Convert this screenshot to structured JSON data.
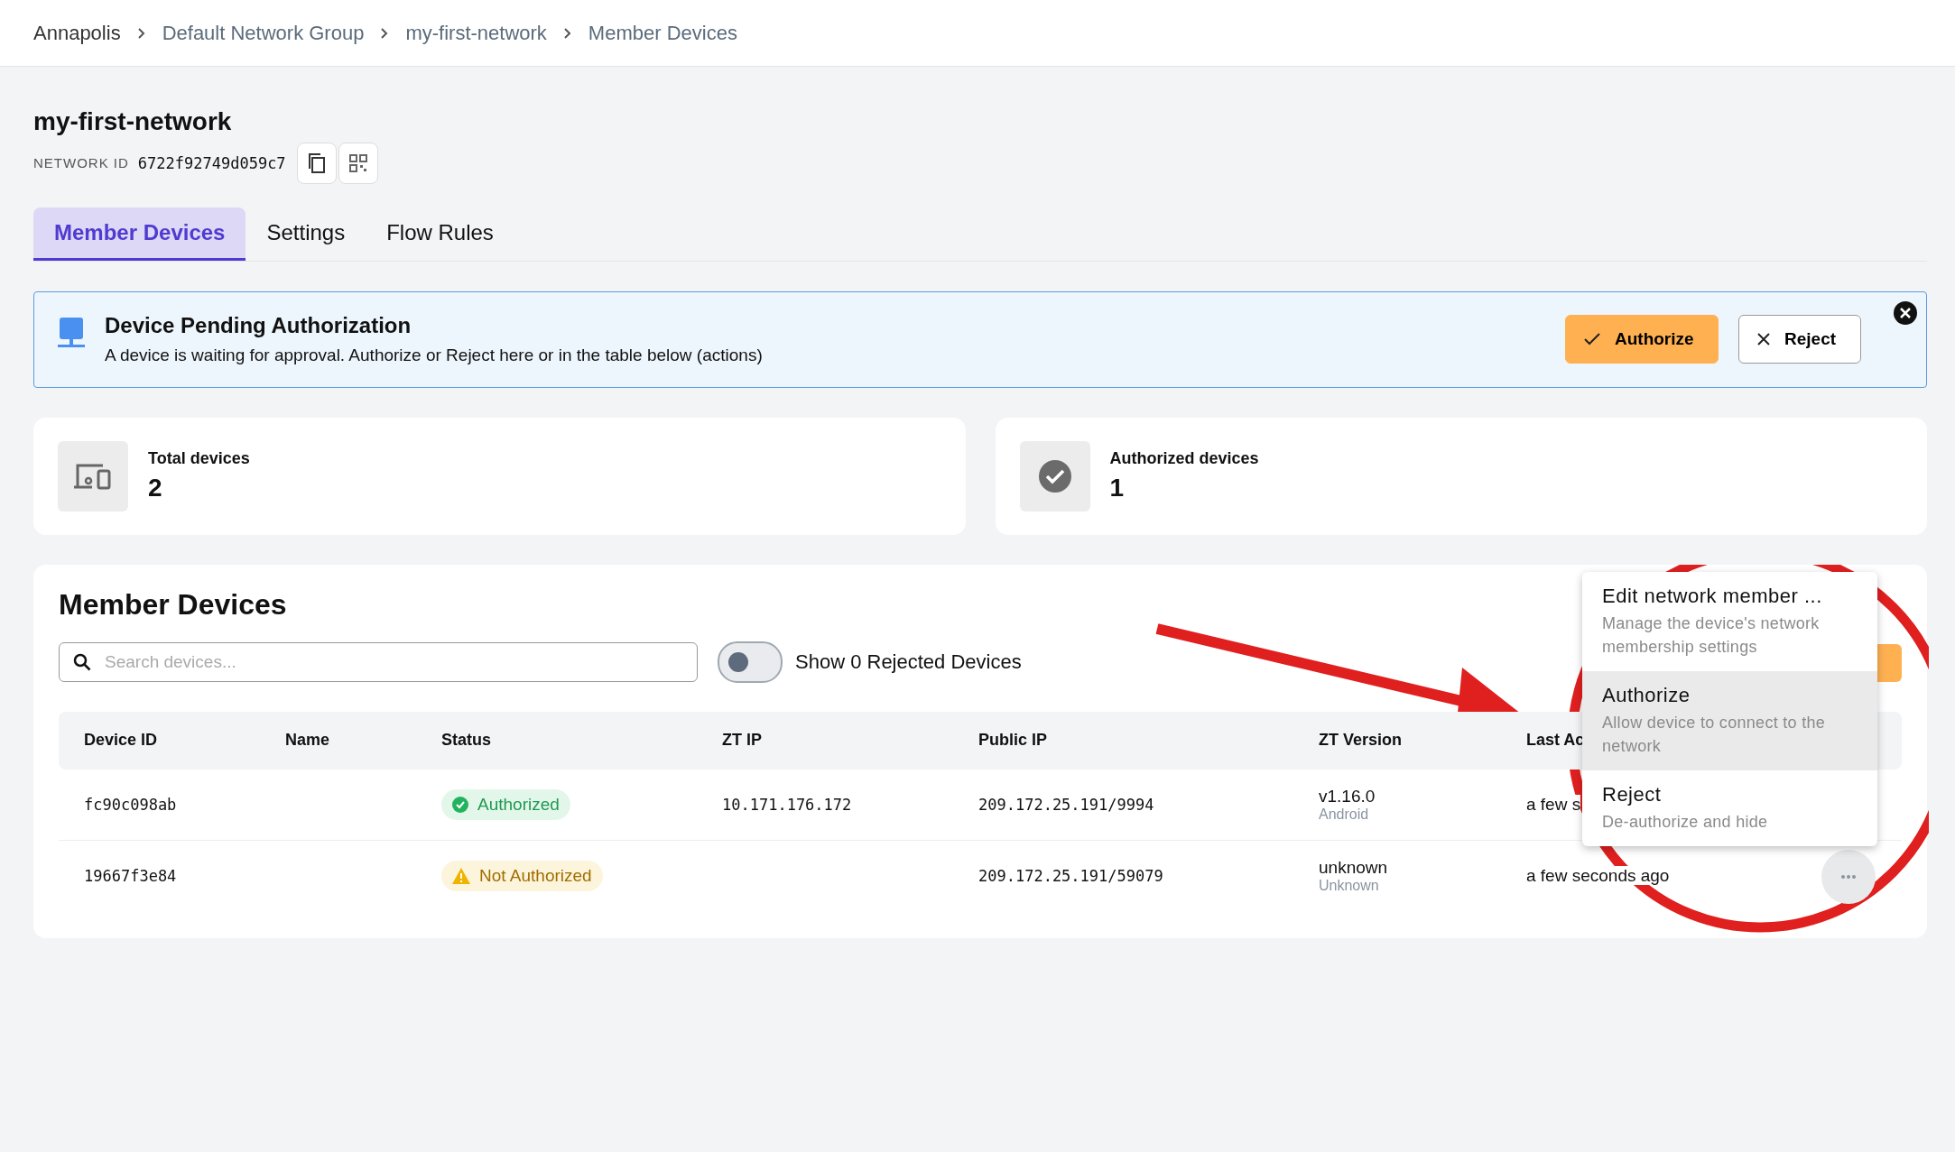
{
  "breadcrumb": [
    "Annapolis",
    "Default Network Group",
    "my-first-network",
    "Member Devices"
  ],
  "network": {
    "name": "my-first-network",
    "id_label": "NETWORK ID",
    "id": "6722f92749d059c7"
  },
  "tabs": [
    {
      "label": "Member Devices",
      "selected": true
    },
    {
      "label": "Settings",
      "selected": false
    },
    {
      "label": "Flow Rules",
      "selected": false
    }
  ],
  "banner": {
    "title": "Device Pending Authorization",
    "message": "A device is waiting for approval. Authorize or Reject here or in the table below (actions)",
    "buttons": [
      {
        "label": "Authorize",
        "kind": "primary"
      },
      {
        "label": "Reject",
        "kind": "secondary"
      }
    ]
  },
  "stats": [
    {
      "label": "Total devices",
      "value": "2",
      "kind": "devices"
    },
    {
      "label": "Authorized devices",
      "value": "1",
      "kind": "check"
    }
  ],
  "members": {
    "title": "Member Devices",
    "search": {
      "placeholder": "Search devices..."
    },
    "toggle": {
      "label": "Show 0 Rejected Devices",
      "on": false
    },
    "columns": [
      "Device ID",
      "Name",
      "Status",
      "ZT IP",
      "Public IP",
      "ZT Version",
      "Last Ac"
    ],
    "rows": [
      {
        "device_id": "fc90c098ab",
        "status": {
          "label": "Authorized",
          "kind": "ok"
        },
        "zt_ip": "10.171.176.172",
        "public_ip": "209.172.25.191/9994",
        "version": "v1.16.0",
        "platform": "Android",
        "last_active": "a few s"
      },
      {
        "device_id": "19667f3e84",
        "status": {
          "label": "Not Authorized",
          "kind": "warning"
        },
        "public_ip": "209.172.25.191/59079",
        "version": "unknown",
        "platform": "Unknown",
        "last_active": "a few seconds ago"
      }
    ]
  },
  "menu": {
    "items": [
      {
        "title": "Edit network member ...",
        "description": "Manage the device's network membership settings",
        "selected": false
      },
      {
        "title": "Authorize",
        "description": "Allow device to connect to the network",
        "selected": true
      },
      {
        "title": "Reject",
        "description": "De-authorize and hide",
        "selected": false
      }
    ]
  }
}
